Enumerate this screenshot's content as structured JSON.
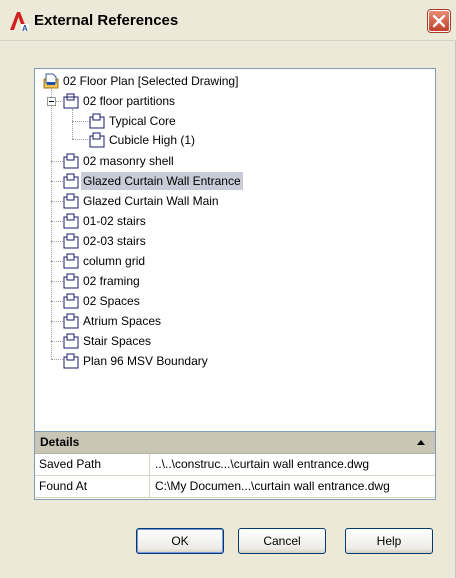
{
  "window": {
    "title": "External References",
    "icon": "autocad-a-icon",
    "close_icon": "close-icon"
  },
  "tree": {
    "root": {
      "label": "02 Floor Plan [Selected Drawing]",
      "icon": "drawing-icon"
    },
    "items": [
      {
        "label": "02 floor partitions",
        "expanded": true,
        "children": [
          {
            "label": "Typical Core"
          },
          {
            "label": "Cubicle High (1)"
          }
        ]
      },
      {
        "label": "02 masonry shell"
      },
      {
        "label": "Glazed Curtain Wall Entrance",
        "selected": true
      },
      {
        "label": "Glazed Curtain Wall Main"
      },
      {
        "label": "01-02 stairs"
      },
      {
        "label": "02-03 stairs"
      },
      {
        "label": "column grid"
      },
      {
        "label": "02 framing"
      },
      {
        "label": "02 Spaces"
      },
      {
        "label": "Atrium Spaces"
      },
      {
        "label": "Stair Spaces"
      },
      {
        "label": "Plan 96 MSV Boundary"
      }
    ],
    "selection_color": "#c9ccd7"
  },
  "details": {
    "header": "Details",
    "rows": [
      {
        "key": "Saved Path",
        "value": "..\\..\\construc...\\curtain wall entrance.dwg"
      },
      {
        "key": "Found At",
        "value": "C:\\My Documen...\\curtain wall entrance.dwg"
      }
    ]
  },
  "buttons": {
    "ok": "OK",
    "cancel": "Cancel",
    "help": "Help"
  },
  "colors": {
    "dialog_bg": "#ece9d8",
    "close_red": "#c2412a",
    "button_border": "#003c74"
  }
}
